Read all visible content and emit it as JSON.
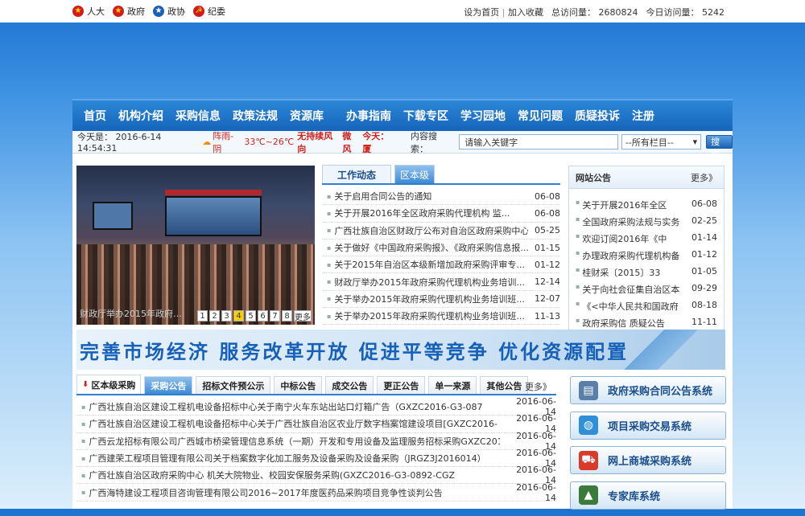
{
  "topbar": {
    "links": [
      {
        "label": "人大",
        "icon": "emblem-icon"
      },
      {
        "label": "政府",
        "icon": "emblem-icon"
      },
      {
        "label": "政协",
        "icon": "emblem-icon"
      },
      {
        "label": "纪委",
        "icon": "party-emblem-icon"
      }
    ],
    "set_home": "设为首页",
    "separator": "|",
    "add_favorite": "加入收藏",
    "total_visits_label": "总访问量：",
    "total_visits": "2680824",
    "today_visits_label": "今日访问量：",
    "today_visits": "5242"
  },
  "nav": {
    "items": [
      "首页",
      "机构介绍",
      "采购信息",
      "政策法规",
      "资源库",
      "办事指南",
      "下载专区",
      "学习园地",
      "常见问题",
      "质疑投诉",
      "注册"
    ]
  },
  "info": {
    "date_label": "今天是：",
    "date": "2016-6-14 14:54:31",
    "weather_icon": "sun-icon",
    "weather": "阵雨-阴",
    "temp": "33℃~26℃",
    "wind": "无持续风向",
    "wind_level": "微风",
    "city": "今天：厦",
    "search_label": "内容搜索：",
    "search_value": "请输入关键字",
    "select_value": "--所有栏目--",
    "search_button": "搜索"
  },
  "slideshow": {
    "caption": "财政厅举办2015年政府…",
    "pages": [
      "1",
      "2",
      "3",
      "4",
      "5",
      "6",
      "7",
      "8"
    ],
    "active_page": "4",
    "more": "更多"
  },
  "news": {
    "tabs": [
      "工作动态",
      "区本级"
    ],
    "items": [
      {
        "title": "关于启用合同公告的通知",
        "date": "06-08"
      },
      {
        "title": "关于开展2016年全区政府采购代理机构 监...",
        "date": "06-08"
      },
      {
        "title": "广西壮族自治区财政厅公布对自治区政府采购中心...",
        "date": "05-25"
      },
      {
        "title": "关于做好《中国政府采购报》、《政府采购信息报...",
        "date": "01-15"
      },
      {
        "title": "关于2015年自治区本级新增加政府采购评审专...",
        "date": "01-12"
      },
      {
        "title": "财政厅举办2015年政府采购代理机构业务培训...",
        "date": "12-14"
      },
      {
        "title": "关于举办2015年政府采购代理机构业务培训班...",
        "date": "12-07"
      },
      {
        "title": "关于举办2015年政府采购代理机构业务培训班...",
        "date": "11-13"
      }
    ]
  },
  "announcements": {
    "title": "网站公告",
    "more": "更多》",
    "items": [
      {
        "title": "关于开展2016年全区",
        "date": "06-08"
      },
      {
        "title": "全国政府采购法规与实务",
        "date": "02-25"
      },
      {
        "title": "欢迎订阅2016年《中",
        "date": "01-14"
      },
      {
        "title": "办理政府采购代理机构备",
        "date": "01-12"
      },
      {
        "title": "桂财采〔2015〕33",
        "date": "01-05"
      },
      {
        "title": "关于向社会征集自治区本",
        "date": "09-29"
      },
      {
        "title": "《<中华人民共和国政府",
        "date": "08-18"
      },
      {
        "title": "政府采购信 质疑公告",
        "date": "11-11"
      }
    ]
  },
  "slogan": "完善市场经济  服务改革开放  促进平等竞争  优化资源配置",
  "procurement": {
    "main_tab": "区本级采购",
    "tabs": [
      "采购公告",
      "招标文件预公示",
      "中标公告",
      "成交公告",
      "更正公告",
      "单一来源",
      "其他公告"
    ],
    "active_tab": "采购公告",
    "more": "更多》",
    "items": [
      {
        "title": "广西壮族自治区建设工程机电设备招标中心关于南宁火车东站出站口灯箱广告（GXZC2016-G3-087",
        "date": "2016-06-14"
      },
      {
        "title": "广西壮族自治区建设工程机电设备招标中心关于广西壮族自治区农业厅数字档案馆建设项目[GXZC2016-",
        "date": "2016-06-14"
      },
      {
        "title": "广西云龙招标有限公司广西城市桥梁管理信息系统（一期）开发和专用设备及监理服务招标采购GXZC2016",
        "date": "2016-06-14"
      },
      {
        "title": "广西建荣工程项目管理有限公司关于档案数字化加工服务及设备采购及设备采购（JRGZ3J2016014）",
        "date": "2016-06-14"
      },
      {
        "title": "广西壮族自治区政府采购中心 机关大院物业、校园安保服务采购(GXZC2016-G3-0892-CGZ",
        "date": "2016-06-14"
      },
      {
        "title": "广西海特建设工程项目咨询管理有限公司2016~2017年度医药品采购项目竞争性谈判公告",
        "date": "2016-06-14"
      }
    ]
  },
  "systems": [
    {
      "label": "政府采购合同公告系统",
      "icon": "document-icon",
      "color": "#5a7fa8"
    },
    {
      "label": "项目采购交易系统",
      "icon": "globe-icon",
      "color": "#2f8fd8"
    },
    {
      "label": "网上商城采购系统",
      "icon": "cart-icon",
      "color": "#d83a2c"
    },
    {
      "label": "专家库系统",
      "icon": "graduation-cap-icon",
      "color": "#3a7a3a"
    }
  ]
}
